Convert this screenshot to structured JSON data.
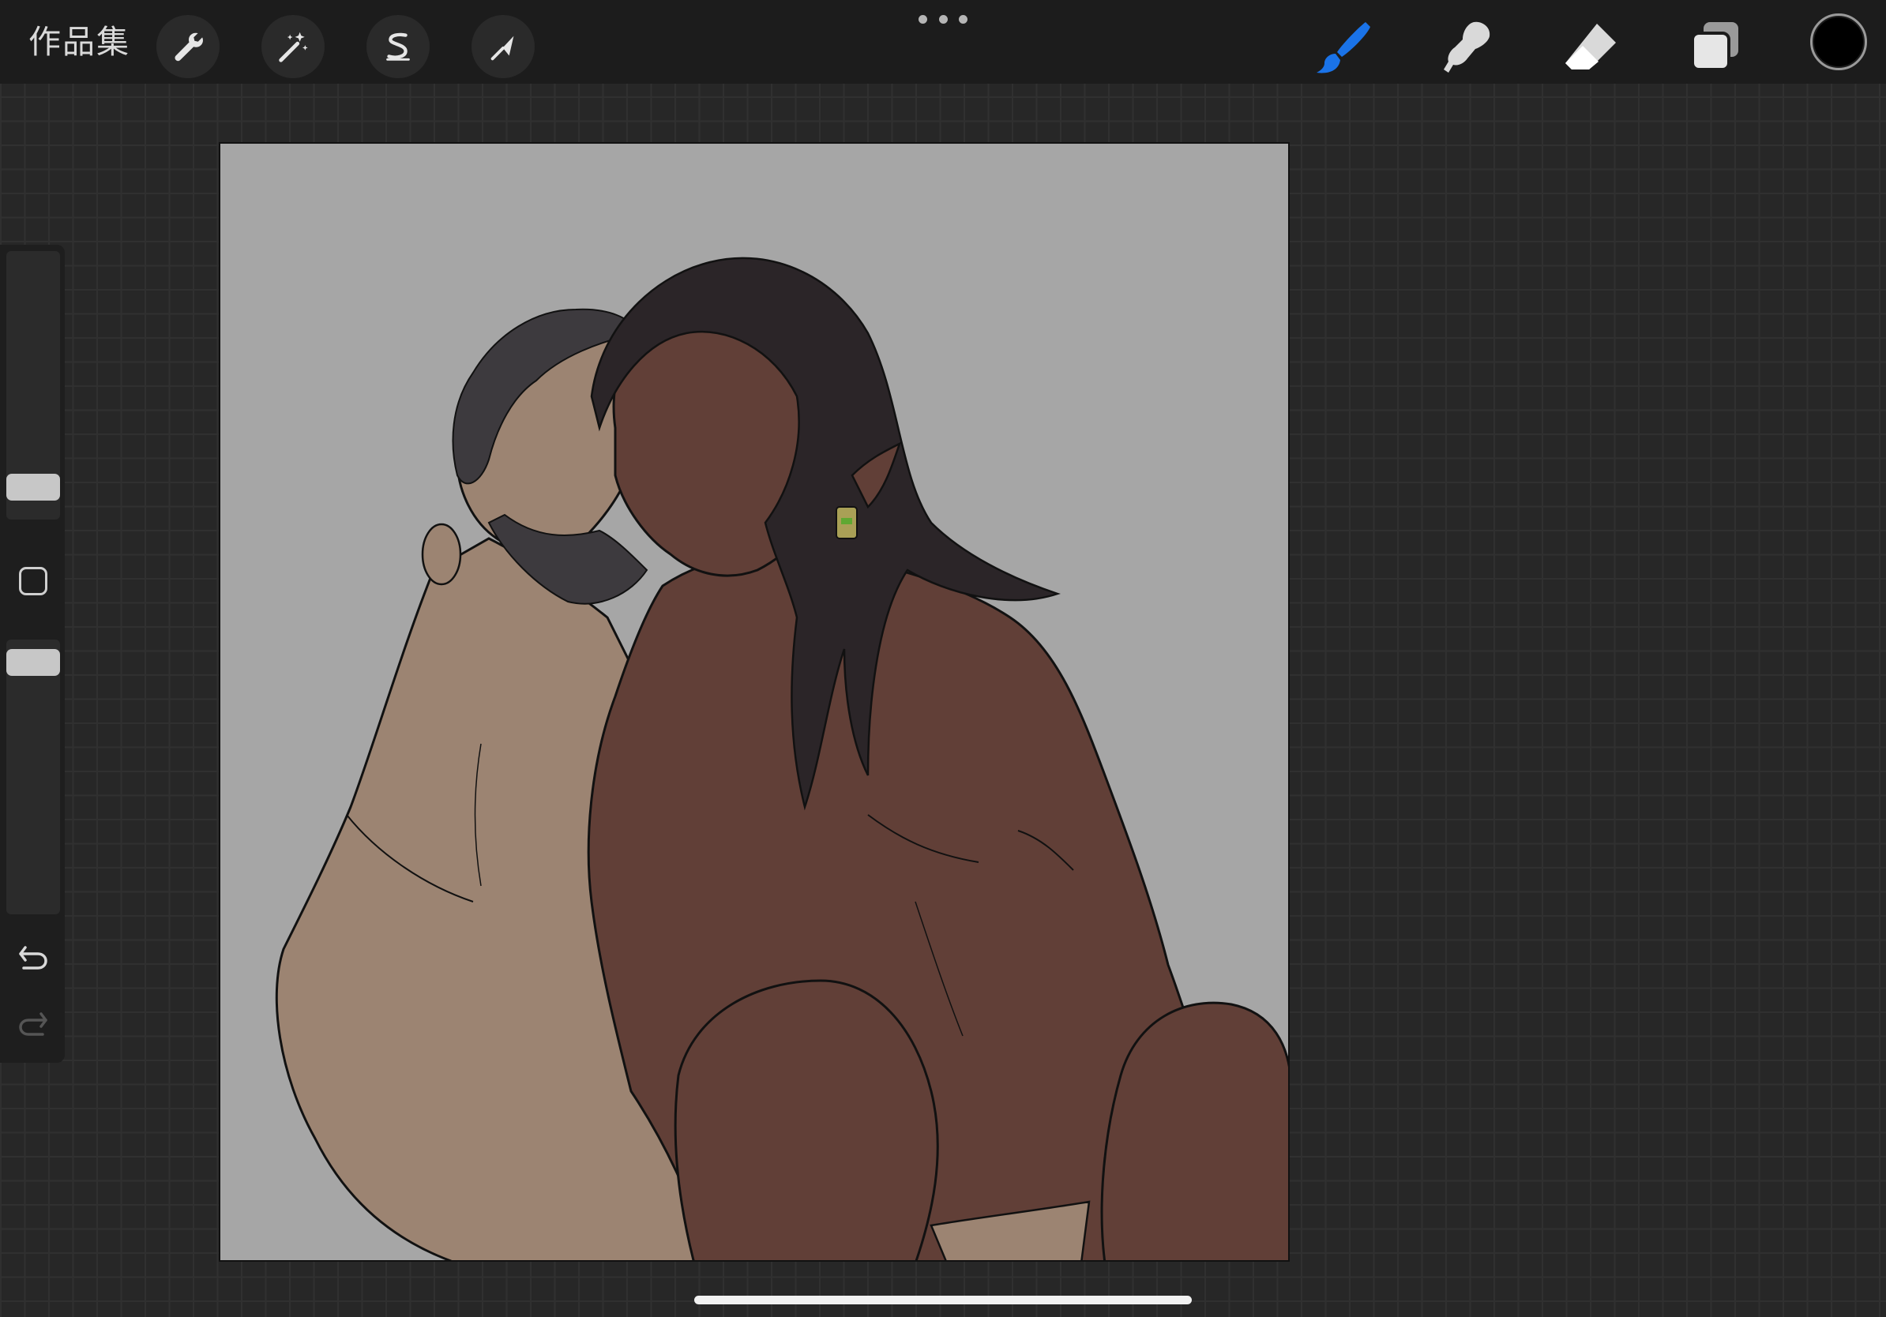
{
  "topbar": {
    "gallery_label": "作品集",
    "actions_icon": "wrench-icon",
    "adjustments_icon": "magic-wand-icon",
    "selection_icon": "selection-s-icon",
    "transform_icon": "arrow-cursor-icon",
    "more_icon": "more-dots-icon",
    "brush_icon": "brush-icon",
    "smudge_icon": "smudge-icon",
    "eraser_icon": "eraser-icon",
    "layers_icon": "layers-icon",
    "current_color": "#000000"
  },
  "sidebar": {
    "brush_size_level": 0.22,
    "opacity_level": 0.9,
    "modify_icon": "square-icon",
    "undo_icon": "undo-arrow-icon",
    "redo_icon": "redo-arrow-icon"
  },
  "canvas": {
    "background_color": "#a6a6a6",
    "artwork": "illustration-two-figures"
  },
  "colors": {
    "accent": "#1a73e8",
    "topbar": "#1c1c1c",
    "workspace": "#272727"
  }
}
